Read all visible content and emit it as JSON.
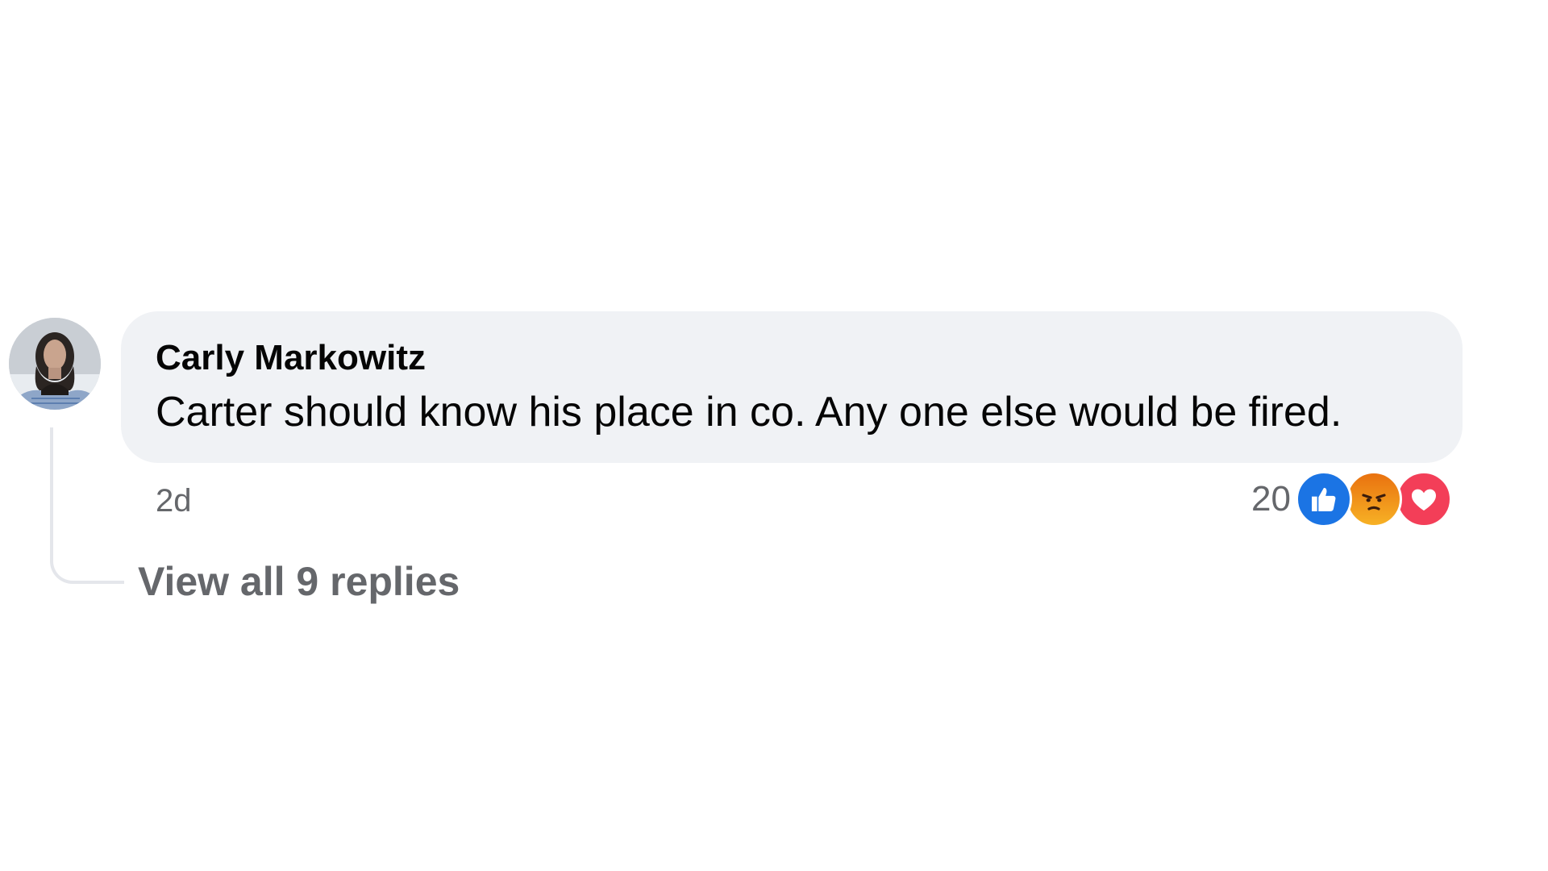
{
  "comment": {
    "author": "Carly Markowitz",
    "text": "Carter should know his place in co. Any one else would be fired.",
    "timestamp": "2d",
    "avatar": "profile-photo",
    "reactions": {
      "count": "20",
      "icons": [
        "like-icon",
        "angry-icon",
        "love-icon"
      ]
    },
    "replies_link": "View all 9 replies"
  },
  "colors": {
    "bubble": "#f0f2f5",
    "secondary_text": "#65676b",
    "primary_text": "#050505",
    "like": "#1b74e4",
    "love": "#f33e58",
    "angry": "#e9710f"
  }
}
